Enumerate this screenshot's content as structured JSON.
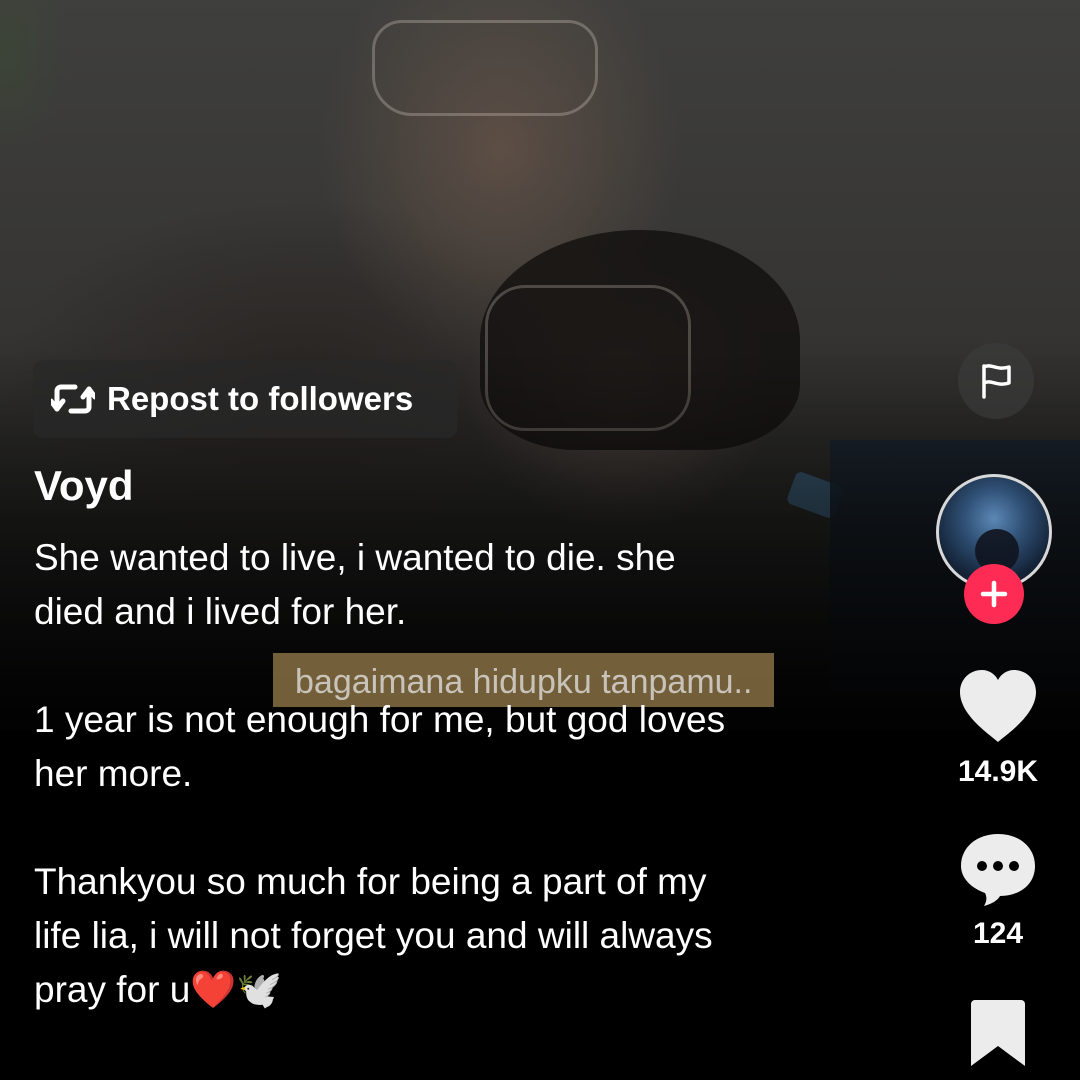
{
  "video": {
    "subtitle": "bagaimana hidupku tanpamu.."
  },
  "repost": {
    "label": "Repost to followers",
    "icon": "repost-icon"
  },
  "post": {
    "username": "Voyd",
    "caption_lines": [
      "She wanted to live, i wanted to die. she",
      "died and i lived for her.",
      "1 year is not enough for me, but god loves",
      "her more.",
      "Thankyou so much for being a part of my",
      "life lia, i will not forget you and will always",
      "pray for u"
    ],
    "caption_emoji": "❤️🕊️"
  },
  "sidebar": {
    "flag_icon": "flag-icon",
    "follow_icon": "plus-icon",
    "likes": "14.9K",
    "comments": "124",
    "like_icon": "heart-icon",
    "comment_icon": "comment-icon",
    "bookmark_icon": "bookmark-icon"
  },
  "colors": {
    "follow_button": "#fe2c55",
    "heart_emoji": "#e0202a",
    "background": "#000000"
  }
}
